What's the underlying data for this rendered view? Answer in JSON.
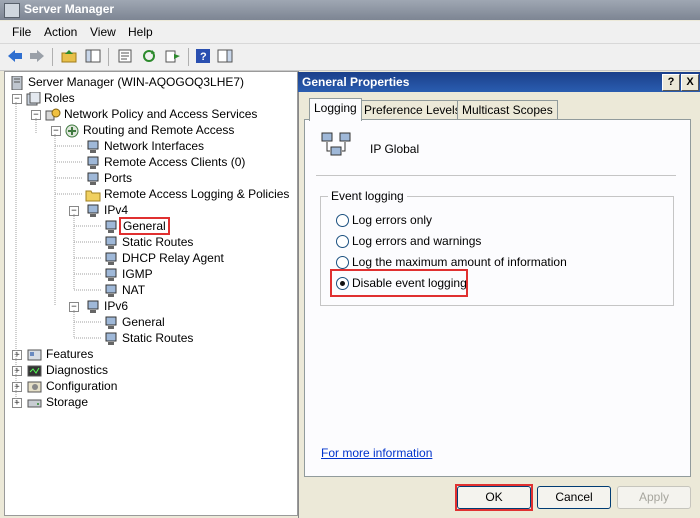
{
  "window": {
    "title": "Server Manager"
  },
  "menu": {
    "items": [
      "File",
      "Action",
      "View",
      "Help"
    ]
  },
  "tree": {
    "root": "Server Manager (WIN-AQOGOQ3LHE7)",
    "roles": "Roles",
    "npas": "Network Policy and Access Services",
    "rras": "Routing and Remote Access",
    "network_interfaces": "Network Interfaces",
    "remote_access_clients": "Remote Access Clients (0)",
    "ports": "Ports",
    "logging": "Remote Access Logging & Policies",
    "ipv4": "IPv4",
    "ipv4_general": "General",
    "ipv4_static_routes": "Static Routes",
    "dhcp_relay": "DHCP Relay Agent",
    "igmp": "IGMP",
    "nat": "NAT",
    "ipv6": "IPv6",
    "ipv6_general": "General",
    "ipv6_static_routes": "Static Routes",
    "features": "Features",
    "diagnostics": "Diagnostics",
    "configuration": "Configuration",
    "storage": "Storage"
  },
  "dialog": {
    "title": "General Properties",
    "help_glyph": "?",
    "close_glyph": "X",
    "tabs": [
      "Logging",
      "Preference Levels",
      "Multicast Scopes"
    ],
    "header_label": "IP Global",
    "group_title": "Event logging",
    "options": [
      "Log errors only",
      "Log errors and warnings",
      "Log the maximum amount of information",
      "Disable event logging"
    ],
    "selected_option": 3,
    "more_info_link": "For more information",
    "buttons": {
      "ok": "OK",
      "cancel": "Cancel",
      "apply": "Apply"
    }
  }
}
